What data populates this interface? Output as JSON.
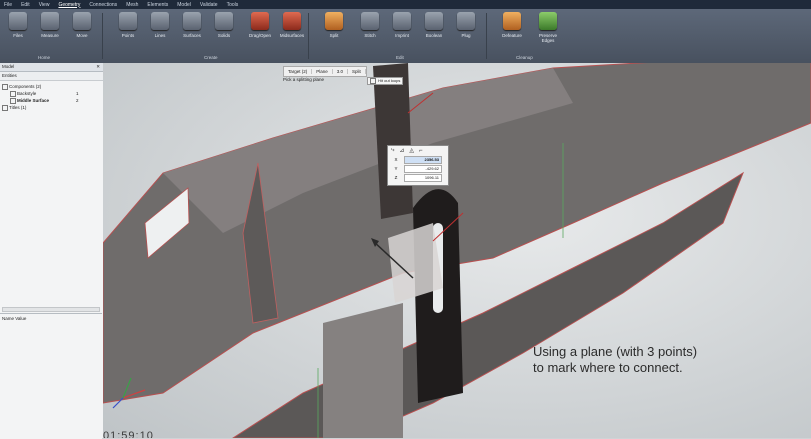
{
  "menubar": {
    "items": [
      "File",
      "Edit",
      "View",
      "Geometry",
      "Connections",
      "Mesh",
      "Elements",
      "Model",
      "Validate",
      "Tools"
    ],
    "active_index": 3
  },
  "ribbon": {
    "buttons": [
      {
        "label": "Files",
        "icon": "files-icon",
        "color": "gray"
      },
      {
        "label": "Measure",
        "icon": "measure-icon",
        "color": "gray"
      },
      {
        "label": "Move",
        "icon": "move-icon",
        "color": "gray"
      },
      {
        "label": "Points",
        "icon": "points-icon",
        "color": "gray"
      },
      {
        "label": "Lines",
        "icon": "lines-icon",
        "color": "gray"
      },
      {
        "label": "Surfaces",
        "icon": "surfaces-icon",
        "color": "gray"
      },
      {
        "label": "Solids",
        "icon": "solids-icon",
        "color": "gray"
      },
      {
        "label": "Drag/Open",
        "icon": "drag-open-icon",
        "color": "red"
      },
      {
        "label": "Midsurfaces",
        "icon": "midsurfaces-icon",
        "color": "red"
      },
      {
        "label": "Split",
        "icon": "split-icon",
        "color": "orange"
      },
      {
        "label": "Stitch",
        "icon": "stitch-icon",
        "color": "gray"
      },
      {
        "label": "Imprint",
        "icon": "imprint-icon",
        "color": "gray"
      },
      {
        "label": "Boolean",
        "icon": "boolean-icon",
        "color": "gray"
      },
      {
        "label": "Plug",
        "icon": "plug-icon",
        "color": "gray"
      },
      {
        "label": "Defeature",
        "icon": "defeature-icon",
        "color": "orange"
      },
      {
        "label": "Preserve Edges",
        "icon": "preserve-edges-icon",
        "color": "green"
      }
    ],
    "groups": [
      "Home",
      "Create",
      "Edit",
      "Cleanup"
    ]
  },
  "sidebar": {
    "title": "Model",
    "tab": "Entities",
    "tree": [
      {
        "label": "Components (2)",
        "indent": 0
      },
      {
        "label": "Backstyle",
        "indent": 1,
        "count": "1"
      },
      {
        "label": "Middle Surface",
        "indent": 1,
        "count": "2",
        "bold": true
      },
      {
        "label": "Titles (1)",
        "indent": 0
      }
    ],
    "lower_header": "Name Value"
  },
  "viewport": {
    "toolbar": {
      "items": [
        "Target (2)",
        "Plane",
        "3.0",
        "Split"
      ]
    },
    "hint": "Pick a splitting plane",
    "checkbox_label": "Hit out loops",
    "coords": [
      {
        "axis": "X",
        "value": "2356.53",
        "selected": true
      },
      {
        "axis": "Y",
        "value": "-429.62",
        "selected": false
      },
      {
        "axis": "Z",
        "value": "1096.11",
        "selected": false
      }
    ],
    "caption": [
      "Using a plane (with 3 points)",
      "to mark where to connect."
    ],
    "bottom_text": "01:59:10"
  }
}
